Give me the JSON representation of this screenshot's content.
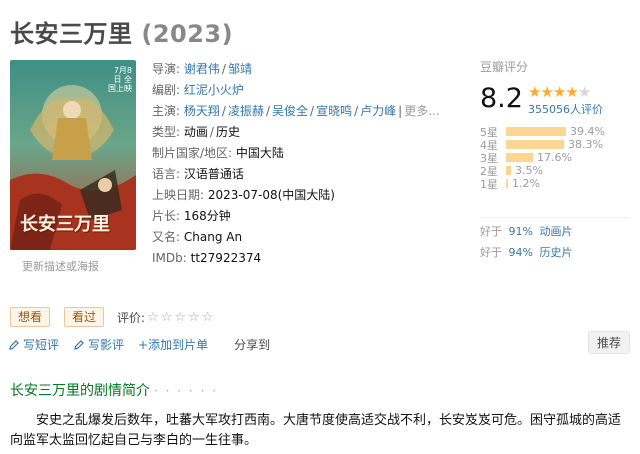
{
  "title": {
    "name": "长安三万里",
    "year": "(2023)"
  },
  "poster": {
    "note": "更新描述或海报",
    "top_text": "7月8日 全国上映",
    "logo_text": "长安三万里"
  },
  "info": {
    "director_label": "导演:",
    "directors": [
      "谢君伟",
      "邹靖"
    ],
    "writer_label": "编剧:",
    "writers": [
      "红泥小火炉"
    ],
    "cast_label": "主演:",
    "cast": [
      "杨天翔",
      "凌振赫",
      "吴俊全",
      "宣晓鸣",
      "卢力峰"
    ],
    "cast_more": "更多...",
    "genre_label": "类型:",
    "genres": [
      "动画",
      "历史"
    ],
    "country_label": "制片国家/地区:",
    "country": "中国大陆",
    "language_label": "语言:",
    "language": "汉语普通话",
    "release_label": "上映日期:",
    "release": "2023-07-08(中国大陆)",
    "runtime_label": "片长:",
    "runtime": "168分钟",
    "aka_label": "又名:",
    "aka": "Chang An",
    "imdb_label": "IMDb:",
    "imdb": "tt27922374"
  },
  "rating": {
    "header": "豆瓣评分",
    "score": "8.2",
    "stars": 4,
    "votes": "355056人评价",
    "distribution": [
      {
        "label": "5星",
        "pct": "39.4%",
        "value": 39.4
      },
      {
        "label": "4星",
        "pct": "38.3%",
        "value": 38.3
      },
      {
        "label": "3星",
        "pct": "17.6%",
        "value": 17.6
      },
      {
        "label": "2星",
        "pct": "3.5%",
        "value": 3.5
      },
      {
        "label": "1星",
        "pct": "1.2%",
        "value": 1.2
      }
    ],
    "better_than": [
      {
        "prefix": "好于",
        "pct": "91%",
        "genre": "动画片"
      },
      {
        "prefix": "好于",
        "pct": "94%",
        "genre": "历史片"
      }
    ]
  },
  "actions": {
    "want": "想看",
    "seen": "看过",
    "rate_label": "评价:"
  },
  "links": {
    "short_review": "写短评",
    "review": "写影评",
    "add_list": "+添加到片单",
    "share": "分享到",
    "recommend": "推荐"
  },
  "section": {
    "title": "长安三万里的剧情简介",
    "dots": "· · · · · ·"
  },
  "summary": "安史之乱爆发后数年，吐蕃大军攻打西南。大唐节度使高适交战不利，长安岌岌可危。困守孤城的高适向监军太监回忆起自己与李白的一生往事。",
  "colors": {
    "link": "#3377aa",
    "star": "#ffac2d",
    "bar": "#ffd596",
    "section": "#007722"
  }
}
